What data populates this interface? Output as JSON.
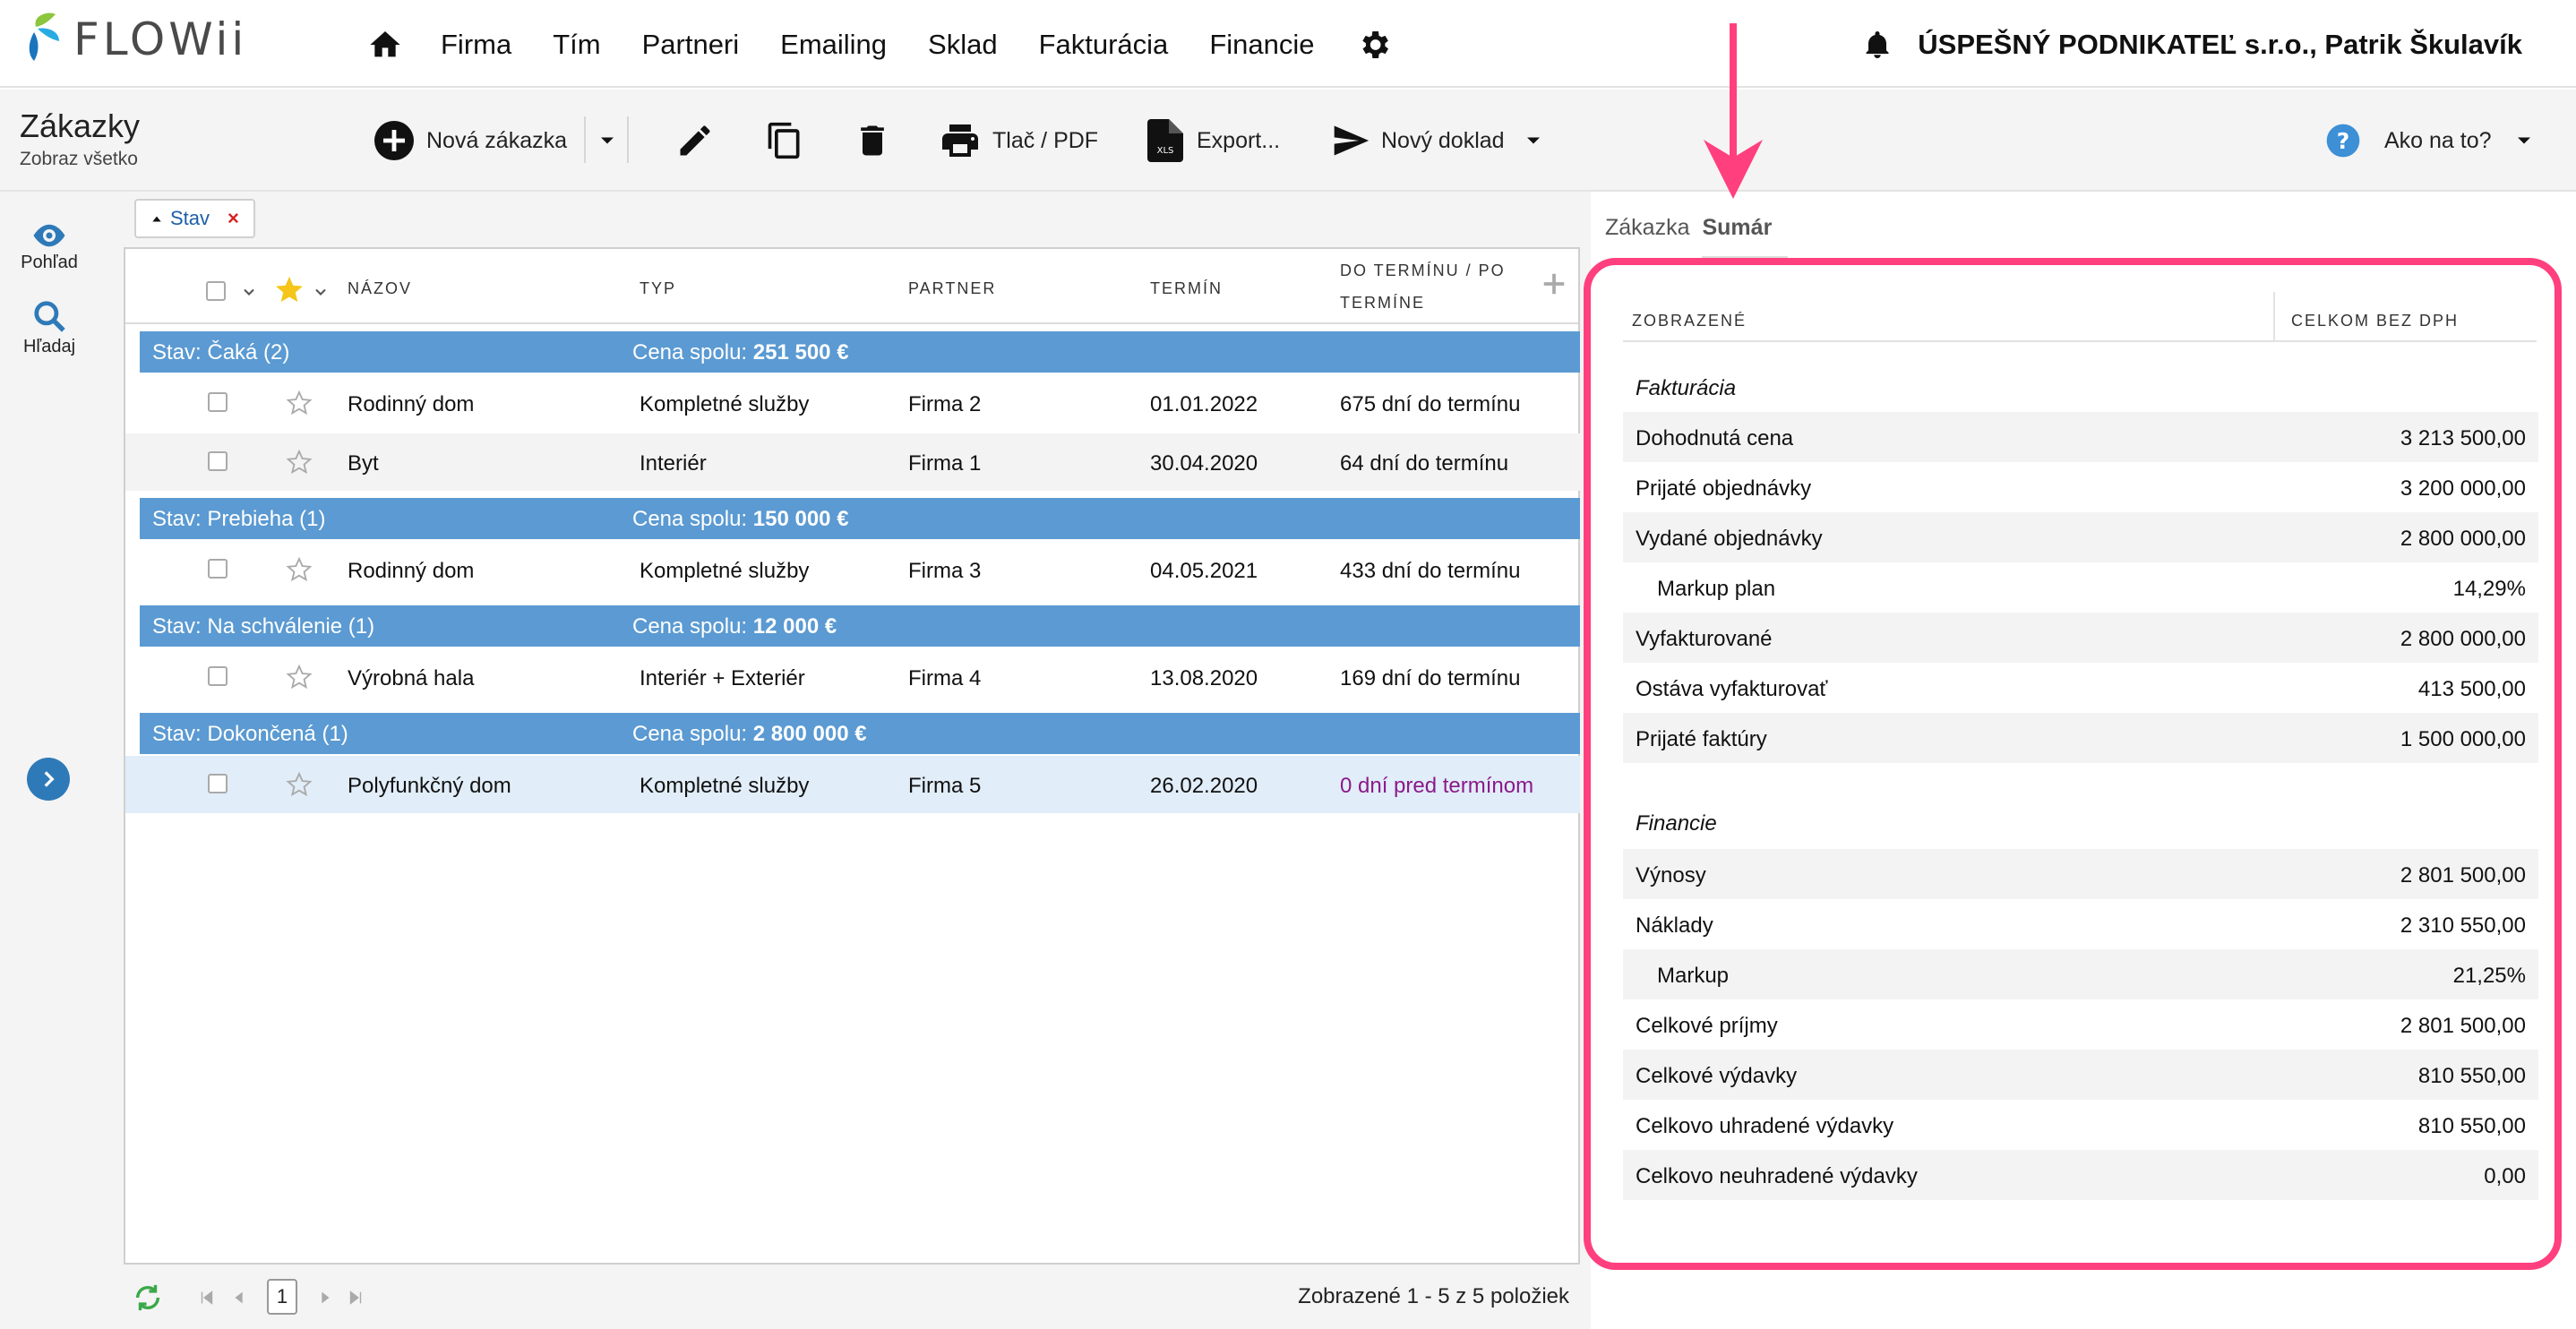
{
  "brand": {
    "logo_text": "FLOWii"
  },
  "nav": {
    "items": [
      "Firma",
      "Tím",
      "Partneri",
      "Emailing",
      "Sklad",
      "Fakturácia",
      "Financie"
    ],
    "home_icon": "home-icon",
    "settings_icon": "gear-icon"
  },
  "user": {
    "label": "ÚSPEŠNÝ PODNIKATEĽ s.r.o., Patrik Škulavík",
    "icon": "bell-icon"
  },
  "page": {
    "title": "Zákazky",
    "subtitle": "Zobraz všetko"
  },
  "toolbar": {
    "new_order": "Nová zákazka",
    "print": "Tlač / PDF",
    "export": "Export...",
    "new_doc": "Nový doklad",
    "help": "Ako na to?"
  },
  "rail": {
    "view": "Pohľad",
    "search": "Hľadaj"
  },
  "filter": {
    "label": "Stav",
    "close": "×"
  },
  "grid": {
    "columns": {
      "name": "NÁZOV",
      "type": "TYP",
      "partner": "PARTNER",
      "term": "TERMÍN",
      "due1": "DO TERMÍNU / PO",
      "due2": "TERMÍNE"
    },
    "groups": [
      {
        "title": "Stav: Čaká (2)",
        "sum_label": "Cena spolu:",
        "sum_value": "251 500 €"
      },
      {
        "title": "Stav: Prebieha (1)",
        "sum_label": "Cena spolu:",
        "sum_value": "150 000 €"
      },
      {
        "title": "Stav: Na schválenie (1)",
        "sum_label": "Cena spolu:",
        "sum_value": "12 000 €"
      },
      {
        "title": "Stav: Dokončená (1)",
        "sum_label": "Cena spolu:",
        "sum_value": "2 800 000 €"
      }
    ],
    "rows": [
      {
        "name": "Rodinný dom",
        "type": "Kompletné služby",
        "partner": "Firma 2",
        "term": "01.01.2022",
        "due": "675 dní do termínu"
      },
      {
        "name": "Byt",
        "type": "Interiér",
        "partner": "Firma 1",
        "term": "30.04.2020",
        "due": "64 dní do termínu"
      },
      {
        "name": "Rodinný dom",
        "type": "Kompletné služby",
        "partner": "Firma 3",
        "term": "04.05.2021",
        "due": "433 dní do termínu"
      },
      {
        "name": "Výrobná hala",
        "type": "Interiér + Exteriér",
        "partner": "Firma 4",
        "term": "13.08.2020",
        "due": "169 dní do termínu"
      },
      {
        "name": "Polyfunkčný dom",
        "type": "Kompletné služby",
        "partner": "Firma 5",
        "term": "26.02.2020",
        "due": "0 dní pred termínom"
      }
    ],
    "footer": {
      "page": "1",
      "summary": "Zobrazené 1 - 5 z 5 položiek"
    }
  },
  "summary": {
    "tabs": [
      "Zákazka",
      "Sumár"
    ],
    "head": {
      "c1": "ZOBRAZENÉ",
      "c2": "CELKOM BEZ DPH"
    },
    "sections": [
      {
        "title": "Fakturácia",
        "rows": [
          {
            "label": "Dohodnutá cena",
            "value": "3 213 500,00"
          },
          {
            "label": "Prijaté objednávky",
            "value": "3 200 000,00"
          },
          {
            "label": "Vydané objednávky",
            "value": "2 800 000,00"
          },
          {
            "label": "Markup plan",
            "value": "14,29%"
          },
          {
            "label": "Vyfakturované",
            "value": "2 800 000,00"
          },
          {
            "label": "Ostáva vyfakturovať",
            "value": "413 500,00"
          },
          {
            "label": "Prijaté faktúry",
            "value": "1 500 000,00"
          }
        ]
      },
      {
        "title": "Financie",
        "rows": [
          {
            "label": "Výnosy",
            "value": "2 801 500,00"
          },
          {
            "label": "Náklady",
            "value": "2 310 550,00"
          },
          {
            "label": "Markup",
            "value": "21,25%"
          },
          {
            "label": "Celkové príjmy",
            "value": "2 801 500,00"
          },
          {
            "label": "Celkové výdavky",
            "value": "810 550,00"
          },
          {
            "label": "Celkovo uhradené výdavky",
            "value": "810 550,00"
          },
          {
            "label": "Celkovo neuhradené výdavky",
            "value": "0,00"
          }
        ]
      }
    ]
  },
  "colors": {
    "accent": "#5b9ad2",
    "highlight": "#ff3f7e",
    "overdue": "#8a1a8a",
    "brand_blue": "#2e7ab8"
  }
}
